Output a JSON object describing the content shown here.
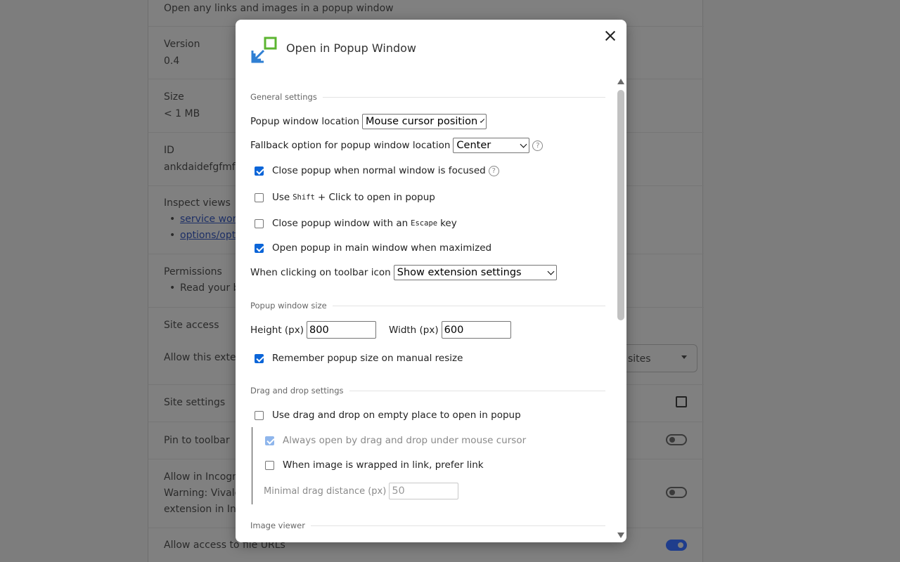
{
  "background": {
    "description_text": "Open any links and images in a popup window",
    "version_label": "Version",
    "version_value": "0.4",
    "size_label": "Size",
    "size_value": "< 1 MB",
    "id_label": "ID",
    "id_value": "ankdaidefgfmfk",
    "inspect_views_label": "Inspect views",
    "inspect_link_1": "service work",
    "inspect_link_2": "options/opt",
    "permissions_label": "Permissions",
    "permissions_item": "Read your b",
    "site_access_label": "Site access",
    "allow_this_ext": "Allow this exter",
    "site_access_select": "sites",
    "site_settings_label": "Site settings",
    "pin_toolbar_label": "Pin to toolbar",
    "allow_incognito_1": "Allow in Incogn",
    "allow_incognito_2": "Warning: Vivald",
    "allow_incognito_3": "extension in Inc",
    "allow_file_urls": "Allow access to file URLs",
    "toggle_pin_on": false,
    "toggle_incognito_on": false,
    "toggle_file_urls_on": true
  },
  "modal": {
    "title": "Open in Popup Window",
    "close_label": "×",
    "help_symbol": "?",
    "general": {
      "heading": "General settings",
      "popup_location_label": "Popup window location",
      "popup_location_value": "Mouse cursor position",
      "fallback_label": "Fallback option for popup window location",
      "fallback_value": "Center",
      "close_focused_label": "Close popup when normal window is focused",
      "shift_pre": "Use",
      "shift_key": "Shift",
      "shift_post": "+ Click to open in popup",
      "escape_pre": "Close popup window with an",
      "escape_key": "Escape",
      "escape_post": "key",
      "maximized_label": "Open popup in main window when maximized",
      "toolbar_label": "When clicking on toolbar icon",
      "toolbar_value": "Show extension settings"
    },
    "size": {
      "heading": "Popup window size",
      "height_label": "Height (px)",
      "height_value": "800",
      "width_label": "Width (px)",
      "width_value": "600",
      "remember_label": "Remember popup size on manual resize"
    },
    "drag": {
      "heading": "Drag and drop settings",
      "empty_place_label": "Use drag and drop on empty place to open in popup",
      "always_mouse_label": "Always open by drag and drop under mouse cursor",
      "prefer_link_label": "When image is wrapped in link, prefer link",
      "min_distance_label": "Minimal drag distance (px)",
      "min_distance_value": "50"
    },
    "image_viewer": {
      "heading": "Image viewer"
    },
    "checkboxes": {
      "close_focused": true,
      "shift_click": false,
      "escape": false,
      "maximized": true,
      "remember_size": true,
      "empty_place": false,
      "always_mouse": true,
      "prefer_link": false
    },
    "colors": {
      "accent": "#0b65d8",
      "logo_green": "#5cb531",
      "logo_blue": "#2f7fd3"
    }
  }
}
